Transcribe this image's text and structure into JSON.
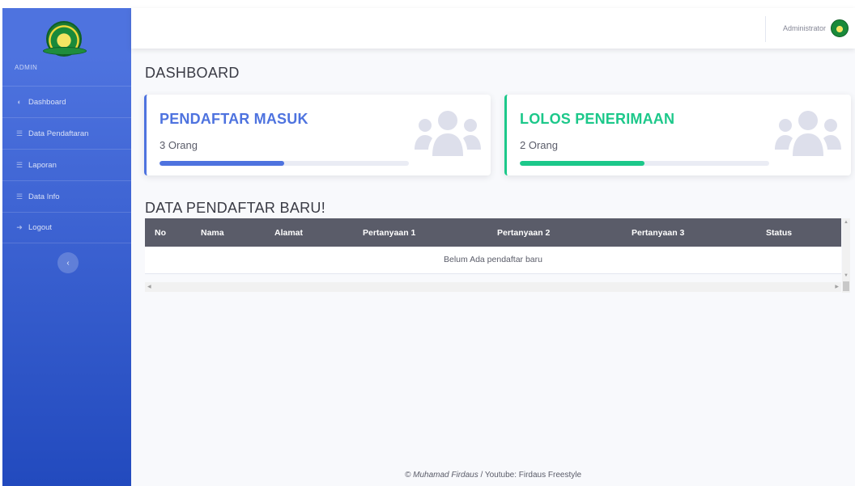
{
  "sidebar": {
    "brand_text": "ADMIN",
    "items": [
      {
        "label": "Dashboard",
        "icon": "dashboard-icon"
      },
      {
        "label": "Data Pendaftaran",
        "icon": "list-icon"
      },
      {
        "label": "Laporan",
        "icon": "list-icon"
      },
      {
        "label": "Data Info",
        "icon": "list-icon"
      },
      {
        "label": "Logout",
        "icon": "logout-icon"
      }
    ],
    "toggle_glyph": "‹"
  },
  "topbar": {
    "user_name": "Administrator"
  },
  "page": {
    "title": "DASHBOARD"
  },
  "cards": [
    {
      "title": "PENDAFTAR MASUK",
      "count": "3 Orang",
      "progress": 0.5,
      "accent": "#4e73df",
      "icon": "users-icon"
    },
    {
      "title": "LOLOS PENERIMAAN",
      "count": "2 Orang",
      "progress": 0.5,
      "accent": "#1cc88a",
      "icon": "users-icon"
    }
  ],
  "table": {
    "section_title": "DATA PENDAFTAR BARU!",
    "columns": [
      "No",
      "Nama",
      "Alamat",
      "Pertanyaan 1",
      "Pertanyaan 2",
      "Pertanyaan 3",
      "Status"
    ],
    "empty_message": "Belum Ada pendaftar baru"
  },
  "footer": {
    "author": "© Muhamad Firdaus",
    "suffix": " / Youtube: Firdaus Freestyle"
  },
  "colors": {
    "sidebar_gradient_top": "#4e73df",
    "sidebar_gradient_bottom": "#224abe",
    "primary": "#4e73df",
    "success": "#1cc88a",
    "table_header": "#5a5c69"
  }
}
